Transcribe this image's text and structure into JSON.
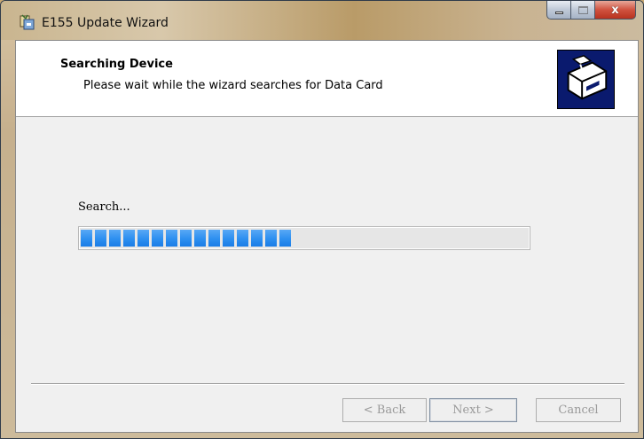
{
  "window": {
    "title": "E155 Update Wizard",
    "controls": {
      "minimize_icon": "minimize-icon",
      "maximize_icon": "maximize-icon",
      "close_icon": "close-icon",
      "close_glyph": "x"
    },
    "app_icon": "installer-icon"
  },
  "header": {
    "title": "Searching Device",
    "subtitle": "Please wait while the wizard searches for Data Card",
    "icon": "computer-drive-icon"
  },
  "main": {
    "status_label": "Search...",
    "progress": {
      "filled_segments": 15,
      "total_segments": 32,
      "fraction": 0.47
    }
  },
  "footer": {
    "back_label": "< Back",
    "next_label": "Next >",
    "cancel_label": "Cancel"
  },
  "colors": {
    "progress_fill": "#2d8ff0",
    "header_icon_bg": "#0a1a6e",
    "close_button": "#c84a37"
  }
}
